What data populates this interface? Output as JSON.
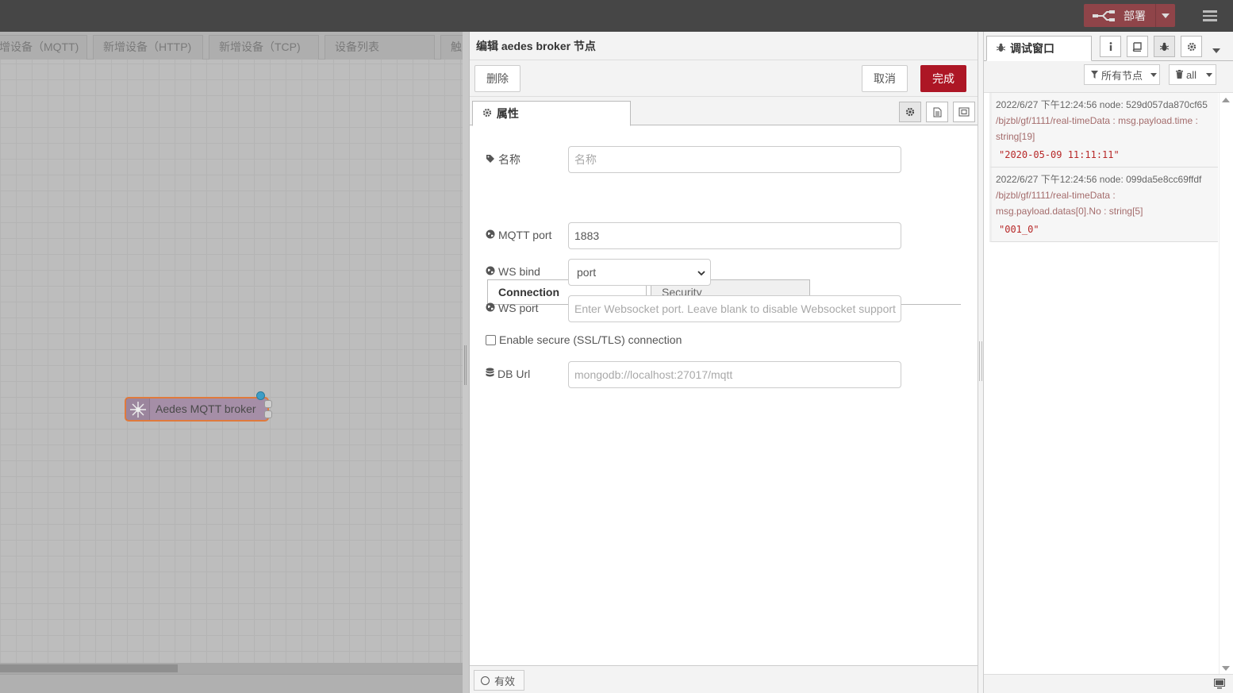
{
  "header": {
    "deploy_label": "部署"
  },
  "workspace": {
    "tabs": [
      {
        "label": "增设备（MQTT)"
      },
      {
        "label": "新增设备（HTTP)"
      },
      {
        "label": "新增设备（TCP)"
      },
      {
        "label": "设备列表"
      },
      {
        "label": "触"
      }
    ],
    "node_label": "Aedes MQTT broker"
  },
  "tray": {
    "title": "编辑 aedes broker 节点",
    "delete_label": "删除",
    "cancel_label": "取消",
    "done_label": "完成",
    "tab_properties": "属性",
    "form": {
      "name_label": "名称",
      "name_placeholder": "名称",
      "subtab_connection": "Connection",
      "subtab_security": "Security",
      "mqtt_port_label": "MQTT port",
      "mqtt_port_value": "1883",
      "ws_bind_label": "WS bind",
      "ws_bind_value": "port",
      "ws_port_label": "WS port",
      "ws_port_placeholder": "Enter Websocket port. Leave blank to disable Websocket support",
      "secure_label": "Enable secure (SSL/TLS) connection",
      "db_url_label": "DB Url",
      "db_url_placeholder": "mongodb://localhost:27017/mqtt"
    },
    "enabled_label": "有效"
  },
  "sidebar": {
    "debug_tab_label": "调试窗口",
    "filter_label": "所有节点",
    "clear_label": "all",
    "messages": [
      {
        "meta": "2022/6/27 下午12:24:56   node: 529d057da870cf65",
        "topic": "/bjzbl/gf/1111/real-timeData : msg.payload.time : string[19]",
        "value": "\"2020-05-09 11:11:11\""
      },
      {
        "meta": "2022/6/27 下午12:24:56   node: 099da5e8cc69ffdf",
        "topic": "/bjzbl/gf/1111/real-timeData : msg.payload.datas[0].No : string[5]",
        "value": "\"001_0\""
      }
    ]
  },
  "colors": {
    "header_bg": "#464646",
    "deploy_bg": "#8f4449",
    "primary_button": "#ad1625",
    "node_fill": "#a58ea7",
    "node_border": "#e07a3c",
    "status_dot": "#3d9dc6"
  }
}
